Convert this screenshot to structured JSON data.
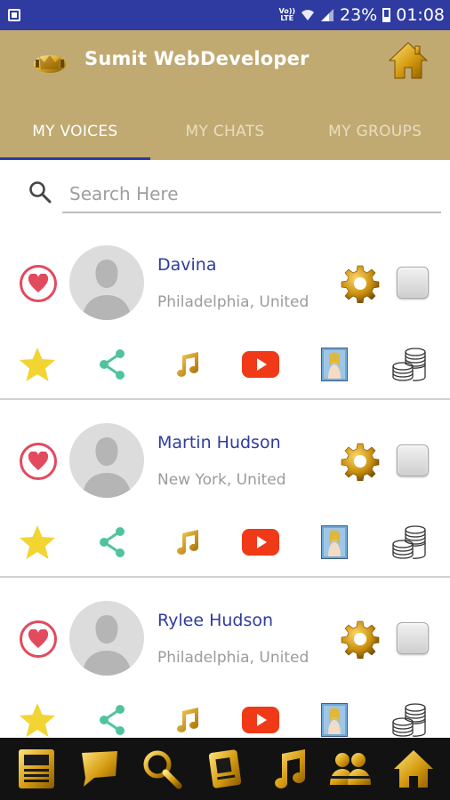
{
  "status_bar": {
    "volte_top": "Vo))",
    "volte_bottom": "LTE",
    "battery_text": "23%",
    "time": "01:08"
  },
  "app_bar": {
    "title": "Sumit WebDeveloper",
    "brand_color": "#c0aa72",
    "accent_color": "#2f3ba0"
  },
  "tabs": [
    {
      "label": "MY VOICES",
      "active": true
    },
    {
      "label": "MY CHATS",
      "active": false
    },
    {
      "label": "MY GROUPS",
      "active": false
    }
  ],
  "search": {
    "placeholder": "Search Here",
    "value": ""
  },
  "users": [
    {
      "name": "Davina",
      "location": "Philadelphia, United"
    },
    {
      "name": "Martin Hudson",
      "location": "New York, United"
    },
    {
      "name": "Rylee Hudson",
      "location": "Philadelphia, United"
    }
  ],
  "card_icons": [
    "heart-icon",
    "avatar",
    "settings-gear-icon",
    "select-checkbox",
    "star-icon",
    "share-icon",
    "music-note-icon",
    "youtube-icon",
    "photo-thumbnail",
    "coins-icon"
  ],
  "bottom_nav": [
    "news-icon",
    "chat-icon",
    "search-icon",
    "id-card-icon",
    "music-icon",
    "group-icon",
    "home-icon"
  ]
}
